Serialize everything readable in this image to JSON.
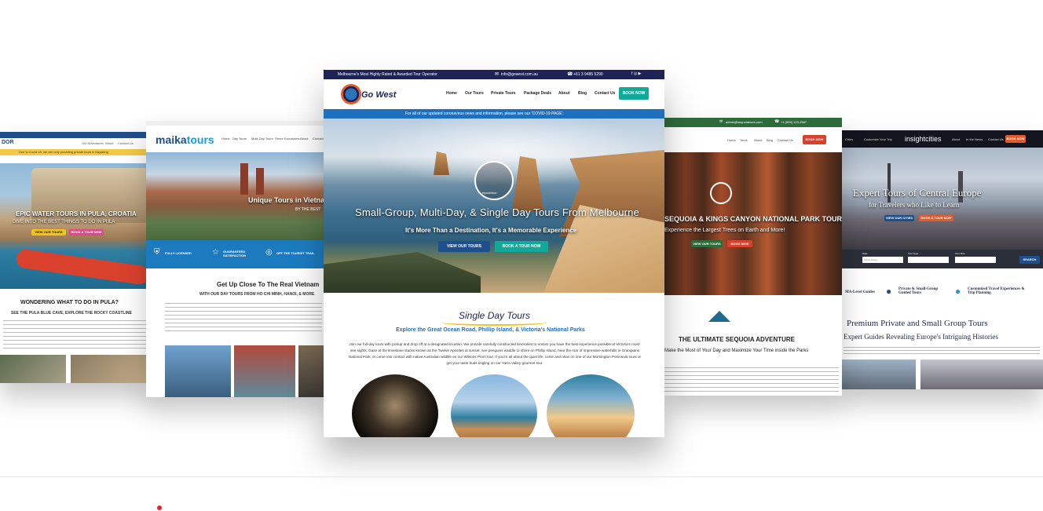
{
  "colors": {
    "teal": "#10a99a",
    "blue": "#1f4e8c",
    "orange": "#e45a2b",
    "navy": "#1d2455",
    "maika_blue": "#1c7bbf"
  },
  "icons": [
    "shield-icon",
    "star-icon",
    "compass-icon",
    "mountain-logo-icon",
    "phone-icon",
    "mail-icon"
  ],
  "card1": {
    "logo": "DOR",
    "covid": "Due to Covid-19, we are only providing private tours in Kayaking",
    "nav": [
      "Our Adventures",
      "About",
      "Contact Us"
    ],
    "hero_title": "EPIC WATER TOURS IN PULA, CROATIA",
    "hero_sub": "DIVE INTO THE BEST THINGS TO DO IN PULA",
    "btn_tours": "VIEW OUR TOURS",
    "btn_book": "BOOK A TOUR NOW",
    "heading": "WONDERING WHAT TO DO IN PULA?",
    "subheading": "SEE THE PULA BLUE CAVE, EXPLORE THE ROCKY COASTLINE"
  },
  "card2": {
    "logo_a": "maika",
    "logo_b": "tours",
    "nav": [
      "Home",
      "Day Tours",
      "Multi-Day Tours",
      "Shore Excursions",
      "About",
      "Contact"
    ],
    "hero_title": "Unique Tours in Vietnam",
    "hero_sub": "BY THE BEST",
    "features": [
      "FULLY LICENSED",
      "GUARANTEED SATISFACTION",
      "OFF THE TOURIST TRAIL"
    ],
    "heading": "Get Up Close To The Real Vietnam",
    "subheading": "WITH OUR DAY TOURS FROM HO CHI MINH, HANOI, & MORE"
  },
  "card3": {
    "topbar_left": "Melbourne's Most Highly Rated & Awarded Tour Operator",
    "email": "info@gowest.com.au",
    "phone": "+61 3 9485 5290",
    "logo": "Go West",
    "nav": [
      "Home",
      "Our Tours",
      "Private Tours",
      "Package Deals",
      "About",
      "Blog",
      "Contact Us"
    ],
    "book_now": "BOOK NOW",
    "covid": "For all of our updated coronavirus news and information, please see our 'COVID-19 PAGE'.",
    "badge": "tripadvisor",
    "hero_title": "Small-Group, Multi-Day, & Single Day Tours From Melbourne",
    "hero_sub": "It's More Than a Destination, It's a Memorable Experience",
    "btn_tours": "VIEW OUR TOURS",
    "btn_book": "BOOK A TOUR NOW",
    "section_title": "Single Day Tours",
    "section_sub": "Explore the Great Ocean Road, Phillip Island, & Victoria's National Parks",
    "para": "Join our full-day tours with pickup and drop off at a designated location. We provide carefully constructed itineraries to ensure you have the best experience possible at Victoria's must-see sights. Gaze at the limestone stacks known as the Twelve Apostles at sunset, see penguins waddle to shore on Phillip Island, hear the roar of impressive waterfalls in Grampians National Park, or come into contact with native Australian wildlife on our Wilsons Prom tour. If you're all about the quiet life, come and relax on one of our Mornington Peninsula tours or get your taste buds tingling on our Yarra Valley gourmet tour."
  },
  "card4": {
    "email": "admin@sequoiatours.com",
    "phone": "+1 (559) 123-4567",
    "nav": [
      "Home",
      "Tours",
      "About",
      "Blog",
      "Contact Us"
    ],
    "book_now": "BOOK NOW",
    "hero_title": "SEQUOIA & KINGS CANYON NATIONAL PARK TOURS",
    "hero_sub": "Experience the Largest Trees on Earth and More!",
    "btn_tours": "VIEW OUR TOURS",
    "btn_book": "BOOK NOW",
    "heading": "THE ULTIMATE SEQUOIA ADVENTURE",
    "subheading": "Make the Most of Your Day and Maximize Your Time inside the Parks"
  },
  "card5": {
    "nav_left": [
      "Cities",
      "Customize Your Trip"
    ],
    "logo": "insightcities",
    "nav": [
      "About",
      "In the News",
      "Contact Us"
    ],
    "book_now": "BOOK NOW",
    "hero_title": "Expert Tours of Central Europe",
    "hero_sub": "for Travelers who Like to Learn",
    "btn_cities": "VIEW OUR CITIES",
    "btn_book": "BOOK A TOUR NOW",
    "search_labels": [
      "Date",
      "Select Dates",
      "Tour Type",
      "Tour Size"
    ],
    "search_btn": "SEARCH",
    "features": [
      "MA-Level Guides",
      "Private & Small-Group Guided Tours",
      "Customized Travel Experiences & Trip Planning"
    ],
    "heading": "Premium Private and Small Group Tours",
    "subheading": "Expert Guides Revealing Europe's Intriguing Histories"
  }
}
